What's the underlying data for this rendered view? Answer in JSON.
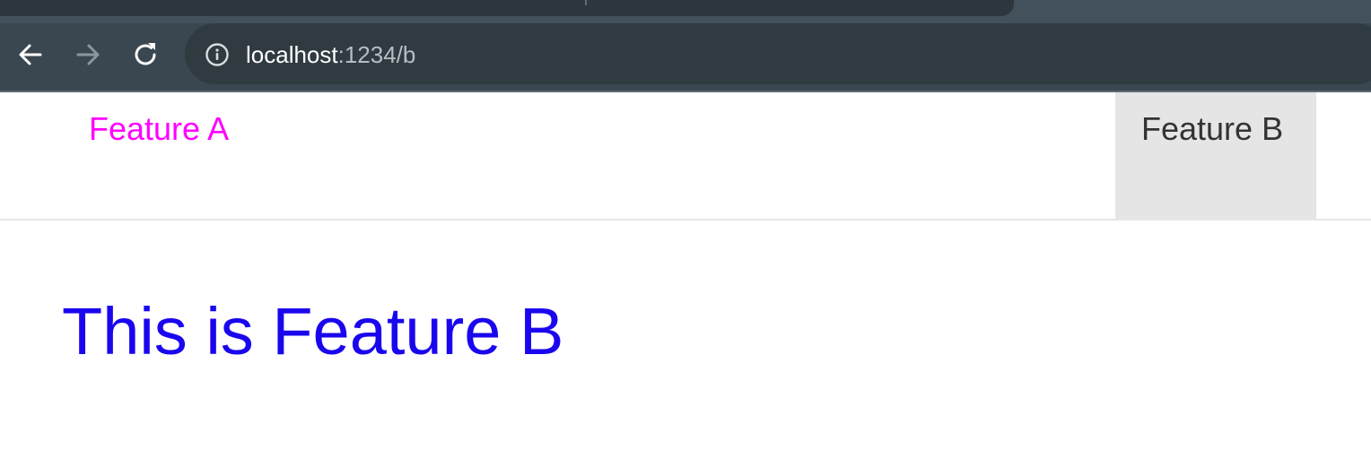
{
  "browser": {
    "address_bar": {
      "host": "localhost",
      "path": ":1234/b"
    },
    "icons": {
      "back": "arrow-left-icon",
      "forward": "arrow-right-icon",
      "reload": "reload-icon",
      "site_info": "info-icon"
    },
    "colors": {
      "chrome_background": "#3b4750",
      "omnibox_background": "#2f3a41"
    }
  },
  "nav": {
    "items": [
      {
        "label": "Feature A",
        "active": false,
        "color": "#ff00ff"
      },
      {
        "label": "Feature B",
        "active": true,
        "color": "#333333"
      }
    ]
  },
  "main": {
    "heading": "This is Feature B",
    "heading_color": "#1a06ee"
  }
}
